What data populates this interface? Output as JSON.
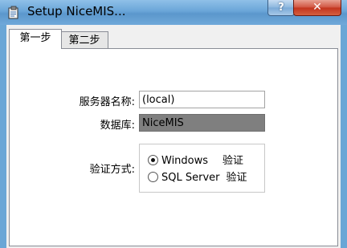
{
  "window": {
    "title": "Setup NiceMIS...",
    "help_label": "?",
    "close_label": "✕"
  },
  "tabs": [
    {
      "label": "第一步",
      "active": true
    },
    {
      "label": "第二步",
      "active": false
    }
  ],
  "form": {
    "server_label": "服务器名称:",
    "server_value": "(local)",
    "database_label": "数据库:",
    "database_value": "NiceMIS",
    "auth_label": "验证方式:",
    "auth_options": [
      {
        "label": "Windows",
        "suffix": "验证",
        "checked": true
      },
      {
        "label": "SQL Server",
        "suffix": "验证",
        "checked": false
      }
    ]
  }
}
